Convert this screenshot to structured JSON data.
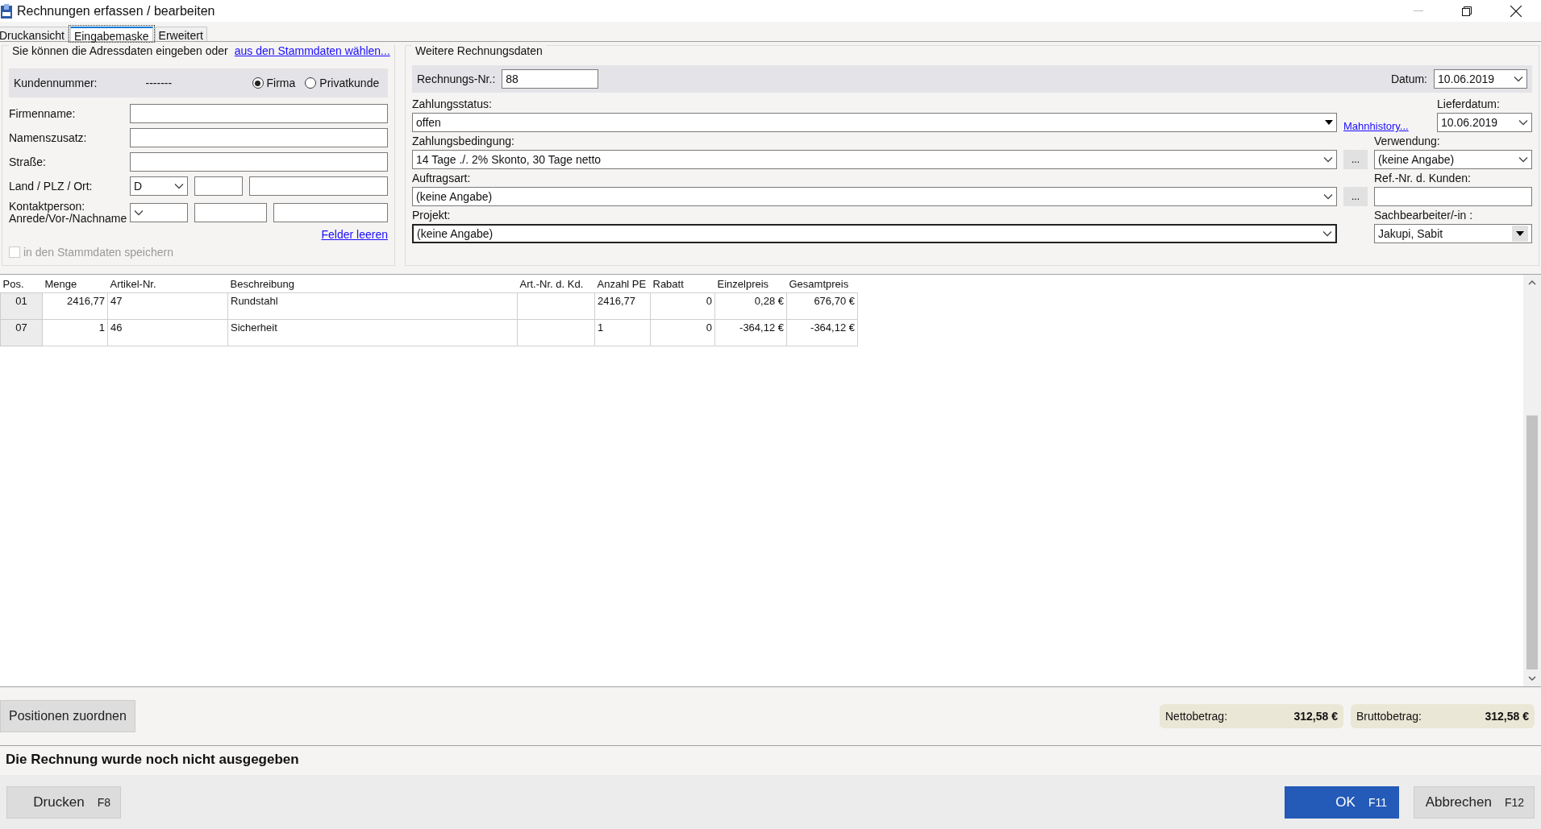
{
  "window": {
    "title": "Rechnungen erfassen / bearbeiten"
  },
  "tabs": [
    {
      "label": "Druckansicht",
      "selected": false
    },
    {
      "label": "Eingabemaske",
      "selected": true
    },
    {
      "label": "Erweitert",
      "selected": false
    }
  ],
  "address": {
    "intro": "Sie können die Adressdaten eingeben oder",
    "link": "aus den Stammdaten wählen...",
    "customer_label": "Kundennummer:",
    "customer_number": "-------",
    "radios": [
      {
        "label": "Firma",
        "selected": true
      },
      {
        "label": "Privatkunde",
        "selected": false
      }
    ],
    "fields": [
      {
        "kind": "text",
        "label": "Firmenname:"
      },
      {
        "kind": "text",
        "label": "Namenszusatz:"
      },
      {
        "kind": "text",
        "label": "Straße:"
      },
      {
        "kind": "land",
        "label": "Land / PLZ / Ort:",
        "value": "D"
      },
      {
        "kind": "contact",
        "label": "Kontaktperson:",
        "label_2": "Anrede/Vor-/Nachname"
      }
    ],
    "clear_link": "Felder leeren",
    "save": {
      "label": "in den Stammdaten speichern",
      "checked": false,
      "disabled": true
    }
  },
  "details": {
    "title": "Weitere Rechnungsdaten",
    "invoice_no": {
      "label": "Rechnungs-Nr.:",
      "value": "88"
    },
    "date": {
      "label": "Datum:",
      "value": "10.06.2019"
    },
    "rows": [
      {
        "main": {
          "kind": "solid",
          "label": "Zahlungsstatus:",
          "value": "offen",
          "focused": false
        },
        "extra": {
          "kind": "link",
          "text": "Mahnhistory..."
        },
        "side": {
          "kind": "chevron",
          "label": "Lieferdatum:",
          "value": "10.06.2019"
        }
      },
      {
        "main": {
          "kind": "chevron",
          "label": "Zahlungsbedingung:",
          "value": "14 Tage ./. 2% Skonto, 30 Tage netto",
          "focused": false
        },
        "extra": {
          "kind": "button",
          "text": "..."
        },
        "side": {
          "kind": "chevron",
          "label": "Verwendung:",
          "value": "(keine Angabe)"
        }
      },
      {
        "main": {
          "kind": "chevron",
          "label": "Auftragsart:",
          "value": "(keine Angabe)",
          "focused": false
        },
        "extra": {
          "kind": "button",
          "text": "..."
        },
        "side": {
          "kind": "text",
          "label": "Ref.-Nr. d. Kunden:"
        }
      },
      {
        "main": {
          "kind": "chevron",
          "label": "Projekt:",
          "value": "(keine Angabe)",
          "focused": true
        },
        "side": {
          "kind": "button",
          "label": "Sachbearbeiter/-in :",
          "value": "Jakupi, Sabit"
        }
      }
    ]
  },
  "table": {
    "columns": [
      "Pos.",
      "Menge",
      "Artikel-Nr.",
      "Beschreibung",
      "Art.-Nr. d. Kd.",
      "Anzahl PE",
      "Rabatt",
      "Einzelpreis",
      "Gesamtpreis"
    ],
    "rows": [
      [
        "01",
        "2416,77",
        "47",
        "Rundstahl",
        "",
        "2416,77",
        "0",
        "0,28 €",
        "676,70 €"
      ],
      [
        "07",
        "1",
        "46",
        "Sicherheit",
        "",
        "1",
        "0",
        "-364,12 €",
        "-364,12 €"
      ]
    ]
  },
  "assign_button": "Positionen zuordnen",
  "totals": [
    {
      "label": "Nettobetrag:",
      "value": "312,58 €"
    },
    {
      "label": "Bruttobetrag:",
      "value": "312,58 €"
    }
  ],
  "status": "Die Rechnung wurde noch nicht ausgegeben",
  "buttons": [
    {
      "kind": "default",
      "label": "Drucken",
      "key": "F8"
    },
    {
      "kind": "spacer"
    },
    {
      "kind": "primary",
      "label": "OK",
      "key": "F11"
    },
    {
      "kind": "default",
      "label": "Abbrechen",
      "key": "F12"
    }
  ]
}
